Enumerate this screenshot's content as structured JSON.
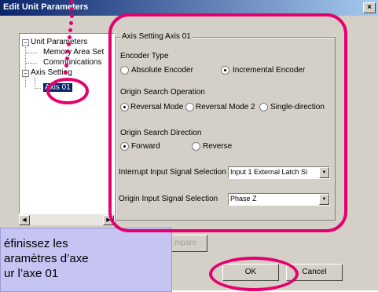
{
  "window": {
    "title": "Edit Unit Parameters",
    "close_glyph": "×"
  },
  "tree": {
    "root": "Unit Parameters",
    "children": [
      "Memory Area Set",
      "Communications",
      "Axis Setting"
    ],
    "selected": "Axis 01",
    "root_toggle": "−",
    "axis_toggle": "−"
  },
  "group": {
    "title": "Axis Setting Axis 01",
    "encoder_type": {
      "label": "Encoder Type",
      "options": [
        "Absolute Encoder",
        "Incremental Encoder"
      ],
      "selected_index": 1
    },
    "origin_search_operation": {
      "label": "Origin Search Operation",
      "options": [
        "Reversal Mode 1",
        "Reversal Mode 2",
        "Single-direction"
      ],
      "selected_index": 0
    },
    "origin_search_direction": {
      "label": "Origin Search Direction",
      "options": [
        "Forward",
        "Reverse"
      ],
      "selected_index": 0
    },
    "interrupt_input": {
      "label": "Interrupt Input Signal Selection",
      "value": "Input 1 External  Latch Si"
    },
    "origin_input": {
      "label": "Origin Input Signal Selection",
      "value": "Phase Z"
    }
  },
  "buttons": {
    "compare": "mpare",
    "ok": "OK",
    "cancel": "Cancel"
  },
  "callout": {
    "text": "éfinissez les\naramètres d’axe\nur l’axe 01"
  },
  "colors": {
    "highlight": "#e6006e",
    "callout_bg": "#c5c4f2",
    "title_bar": "#0a246a"
  }
}
